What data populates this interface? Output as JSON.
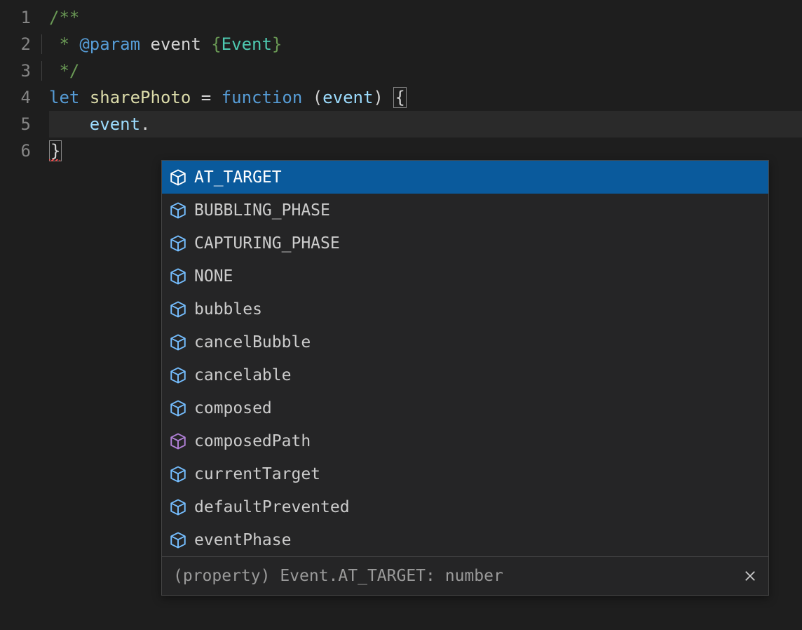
{
  "lineNumbers": [
    "1",
    "2",
    "3",
    "4",
    "5",
    "6"
  ],
  "code": {
    "l1": {
      "open": "/**"
    },
    "l2": {
      "star": " * ",
      "tag": "@param",
      "sp1": " ",
      "name": "event",
      "sp2": " ",
      "lb": "{",
      "type": "Event",
      "rb": "}"
    },
    "l3": {
      "close": " */"
    },
    "l4": {
      "kw_let": "let",
      "sp1": " ",
      "fn": "sharePhoto",
      "sp2": " ",
      "eq": "=",
      "sp3": " ",
      "kw_fn": "function",
      "sp4": " ",
      "lp": "(",
      "param": "event",
      "rp": ")",
      "sp5": " ",
      "lb": "{"
    },
    "l5": {
      "indent": "    ",
      "obj": "event",
      "dot": "."
    },
    "l6": {
      "rb": "}"
    }
  },
  "suggestions": [
    {
      "label": "AT_TARGET",
      "kind": "field",
      "selected": true
    },
    {
      "label": "BUBBLING_PHASE",
      "kind": "field",
      "selected": false
    },
    {
      "label": "CAPTURING_PHASE",
      "kind": "field",
      "selected": false
    },
    {
      "label": "NONE",
      "kind": "field",
      "selected": false
    },
    {
      "label": "bubbles",
      "kind": "field",
      "selected": false
    },
    {
      "label": "cancelBubble",
      "kind": "field",
      "selected": false
    },
    {
      "label": "cancelable",
      "kind": "field",
      "selected": false
    },
    {
      "label": "composed",
      "kind": "field",
      "selected": false
    },
    {
      "label": "composedPath",
      "kind": "method",
      "selected": false
    },
    {
      "label": "currentTarget",
      "kind": "field",
      "selected": false
    },
    {
      "label": "defaultPrevented",
      "kind": "field",
      "selected": false
    },
    {
      "label": "eventPhase",
      "kind": "field",
      "selected": false
    }
  ],
  "detail": "(property) Event.AT_TARGET: number"
}
